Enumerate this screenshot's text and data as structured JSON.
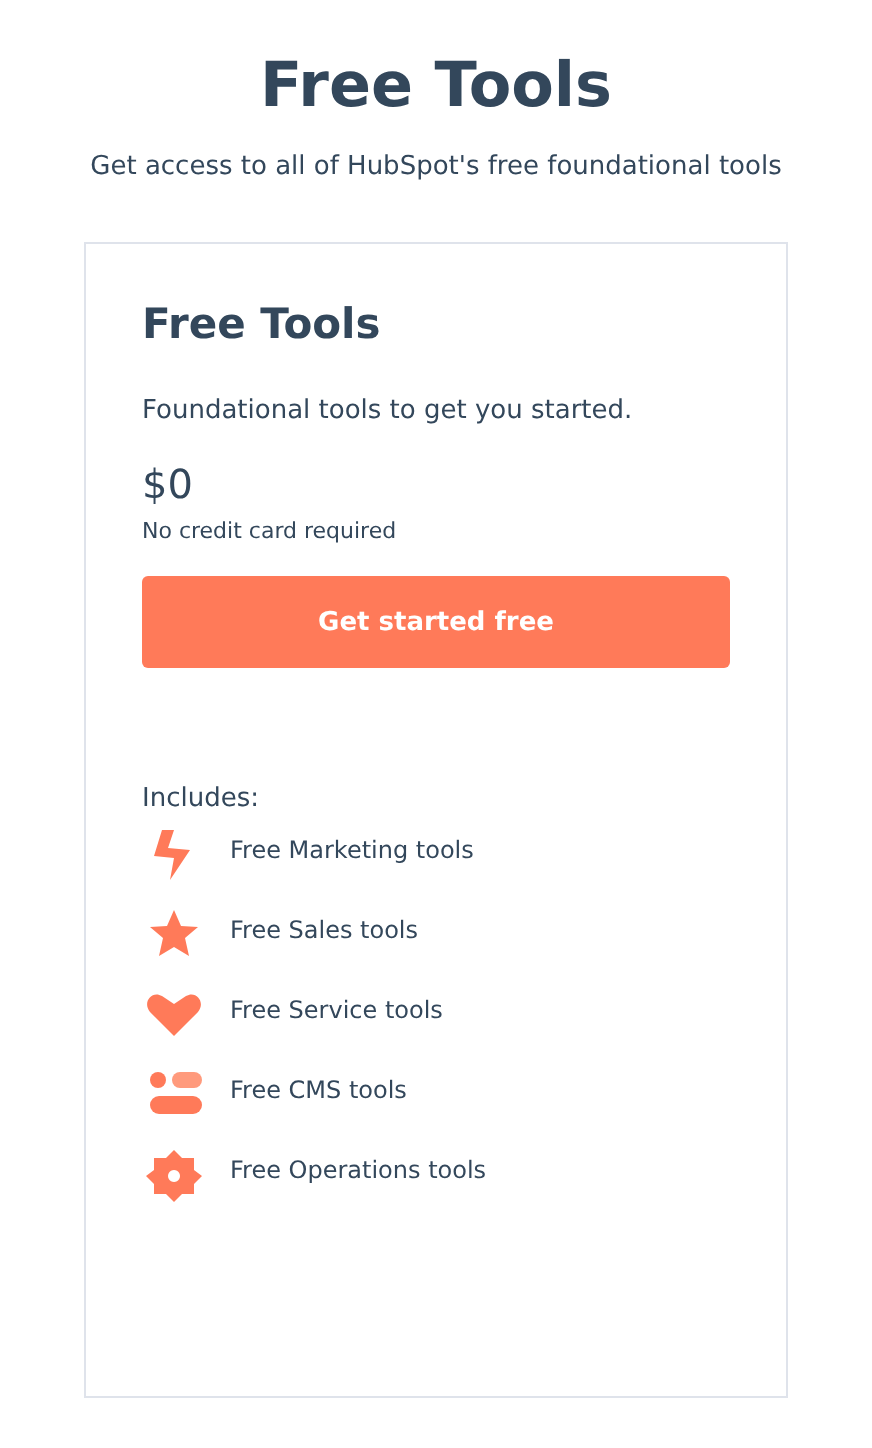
{
  "header": {
    "title": "Free Tools",
    "subtitle": "Get access to all of HubSpot's free foundational tools"
  },
  "card": {
    "title": "Free Tools",
    "description": "Foundational tools to get you started.",
    "price": "$0",
    "price_note": "No credit card required",
    "button": "Get started free",
    "includes_label": "Includes:",
    "items": [
      {
        "kind": "marketing",
        "label": "Free Marketing tools"
      },
      {
        "kind": "sales",
        "label": "Free Sales tools"
      },
      {
        "kind": "service",
        "label": "Free Service tools"
      },
      {
        "kind": "cms",
        "label": "Free CMS tools"
      },
      {
        "kind": "operations",
        "label": "Free Operations tools"
      }
    ]
  }
}
